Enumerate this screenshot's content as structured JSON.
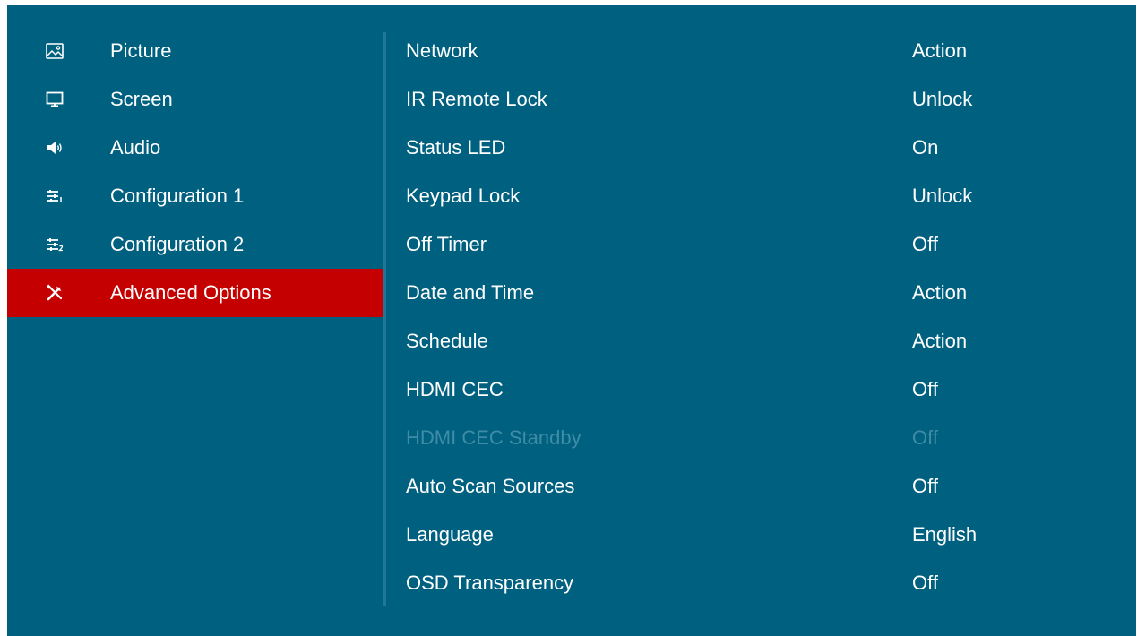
{
  "sidebar": {
    "items": [
      {
        "label": "Picture",
        "icon": "picture-icon",
        "selected": false
      },
      {
        "label": "Screen",
        "icon": "monitor-icon",
        "selected": false
      },
      {
        "label": "Audio",
        "icon": "speaker-icon",
        "selected": false
      },
      {
        "label": "Configuration 1",
        "icon": "config1-icon",
        "selected": false
      },
      {
        "label": "Configuration 2",
        "icon": "config2-icon",
        "selected": false
      },
      {
        "label": "Advanced Options",
        "icon": "tools-icon",
        "selected": true
      }
    ]
  },
  "options": {
    "rows": [
      {
        "label": "Network",
        "value": "Action",
        "enabled": true
      },
      {
        "label": "IR Remote Lock",
        "value": "Unlock",
        "enabled": true
      },
      {
        "label": "Status LED",
        "value": "On",
        "enabled": true
      },
      {
        "label": "Keypad Lock",
        "value": "Unlock",
        "enabled": true
      },
      {
        "label": "Off Timer",
        "value": "Off",
        "enabled": true
      },
      {
        "label": "Date and Time",
        "value": "Action",
        "enabled": true
      },
      {
        "label": "Schedule",
        "value": "Action",
        "enabled": true
      },
      {
        "label": "HDMI CEC",
        "value": "Off",
        "enabled": true
      },
      {
        "label": "HDMI CEC Standby",
        "value": "Off",
        "enabled": false
      },
      {
        "label": "Auto Scan Sources",
        "value": "Off",
        "enabled": true
      },
      {
        "label": "Language",
        "value": "English",
        "enabled": true
      },
      {
        "label": "OSD Transparency",
        "value": "Off",
        "enabled": true
      }
    ]
  },
  "colors": {
    "background": "#00607f",
    "selected": "#c40000",
    "disabled_text": "#3f8ca6",
    "text": "#ffffff"
  }
}
